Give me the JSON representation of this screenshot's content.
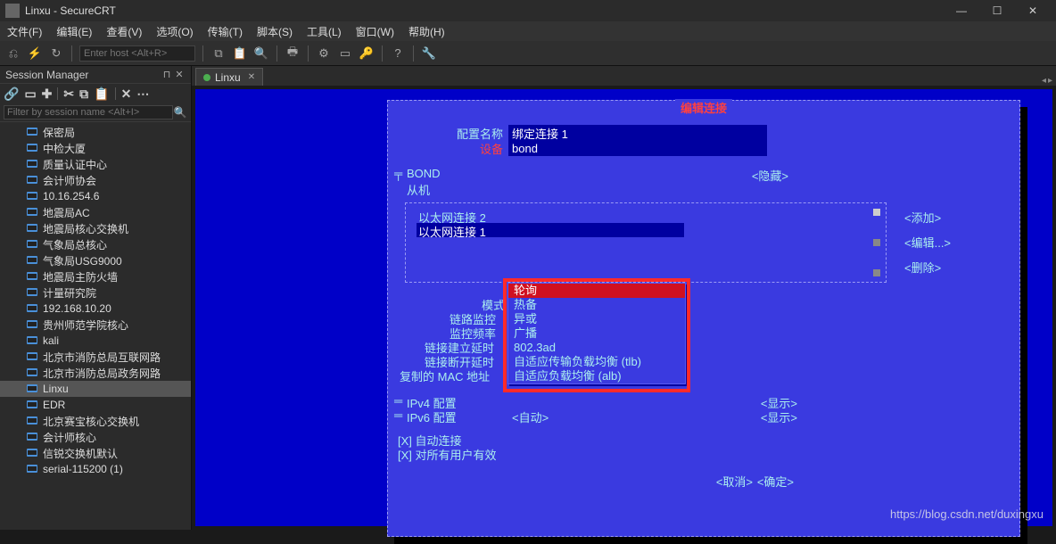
{
  "window": {
    "title": "Linxu - SecureCRT",
    "controls": {
      "min": "—",
      "max": "☐",
      "close": "✕"
    }
  },
  "menu": [
    "文件(F)",
    "编辑(E)",
    "查看(V)",
    "选项(O)",
    "传输(T)",
    "脚本(S)",
    "工具(L)",
    "窗口(W)",
    "帮助(H)"
  ],
  "toolbar": {
    "host_placeholder": "Enter host <Alt+R>"
  },
  "session_manager": {
    "title": "Session Manager",
    "filter_placeholder": "Filter by session name <Alt+I>",
    "items": [
      "保密局",
      "中检大厦",
      "质量认证中心",
      "会计师协会",
      "10.16.254.6",
      "地震局AC",
      "地震局核心交换机",
      "气象局总核心",
      "气象局USG9000",
      "地震局主防火墙",
      "计量研究院",
      "192.168.10.20",
      "贵州师范学院核心",
      "kali",
      "北京市消防总局互联网路",
      "北京市消防总局政务网路",
      "Linxu",
      "EDR",
      "北京赛宝核心交换机",
      "会计师核心",
      "信锐交换机默认",
      "serial-115200 (1)"
    ],
    "selected": "Linxu"
  },
  "tab": {
    "label": "Linxu"
  },
  "dialog": {
    "title": "编辑连接",
    "config_name_label": "配置名称",
    "config_name_value": "绑定连接 1",
    "device_label": "设备",
    "device_value": "bond",
    "bond_label": "BOND",
    "slaves_label": "从机",
    "hide_btn": "<隐藏>",
    "slaves": [
      "以太网连接 2",
      "以太网连接 1"
    ],
    "slave_selected": "以太网连接 1",
    "add_btn": "<添加>",
    "edit_btn": "<编辑...>",
    "delete_btn": "<删除>",
    "mode_label": "模式",
    "link_monitor_label": "链路监控",
    "monitor_freq_label": "监控频率",
    "link_up_delay_label": "链接建立延时",
    "link_down_delay_label": "链接断开延时",
    "cloned_mac_label": "复制的 MAC 地址",
    "dropdown_options": [
      "轮询",
      "热备",
      "异或",
      "广播",
      "802.3ad",
      "自适应传输负载均衡 (tlb)",
      "自适应负载均衡 (alb)"
    ],
    "dropdown_selected": "轮询",
    "ipv4_label": "IPv4 配置",
    "ipv6_label": "IPv6 配置",
    "ipv6_value": "<自动>",
    "show_btn": "<显示>",
    "autoconnect": "自动连接",
    "all_users": "对所有用户有效",
    "cancel": "<取消>",
    "ok": "<确定>"
  },
  "watermark": "https://blog.csdn.net/duxingxu"
}
